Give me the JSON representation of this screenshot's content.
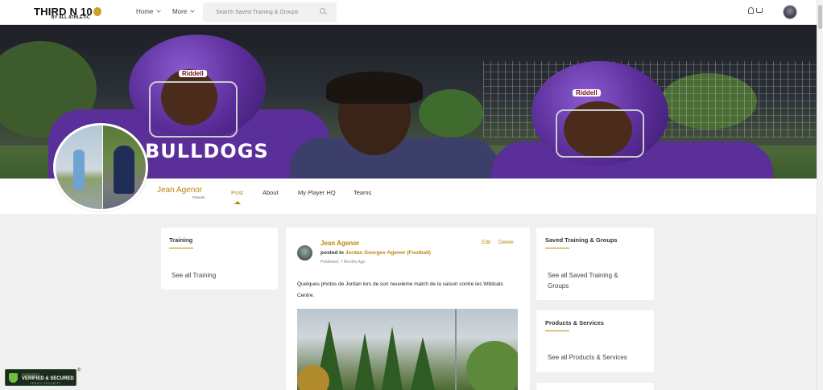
{
  "nav": {
    "logo_text": "THIRD N 10",
    "logo_sub": "BY ALL ATHLETIC",
    "menu": [
      {
        "label": "Home"
      },
      {
        "label": "More"
      }
    ],
    "search_placeholder": "Search Saved Training & Groups"
  },
  "cover": {
    "jersey_text": "BULLDOGS",
    "helmet_brand": "Riddell"
  },
  "profile": {
    "name": "Jean Agenor",
    "role": "Parents",
    "tabs": [
      {
        "label": "Post",
        "active": true
      },
      {
        "label": "About",
        "active": false
      },
      {
        "label": "My Player HQ",
        "active": false
      },
      {
        "label": "Teams",
        "active": false
      }
    ]
  },
  "left_sidebar": {
    "training": {
      "title": "Training",
      "link": "See all Training"
    }
  },
  "post": {
    "author": "Jean Agenor",
    "posted_label": "posted in",
    "posted_target": "Jordan Georges-Agenor (Football)",
    "time": "Published: 7 Months Ago",
    "edit_label": "Edit",
    "delete_label": "Delete",
    "text": "Quelques photos de Jordan lors de son neuvième match de la saison contre les Wildcats Centre."
  },
  "right_sidebar": {
    "saved": {
      "title": "Saved Training & Groups",
      "link": "See all Saved Training & Groups"
    },
    "products": {
      "title": "Products & Services",
      "link": "See all Products & Services"
    }
  },
  "badge": {
    "title": "GODADDY",
    "main": "VERIFIED & SECURED",
    "sub": "VERIFY SECURITY",
    "reg": "®"
  },
  "colors": {
    "accent": "#b8860b",
    "page_bg": "#f1f0f0",
    "card_bg": "#ffffff",
    "jersey_purple": "#5b2f9a"
  }
}
